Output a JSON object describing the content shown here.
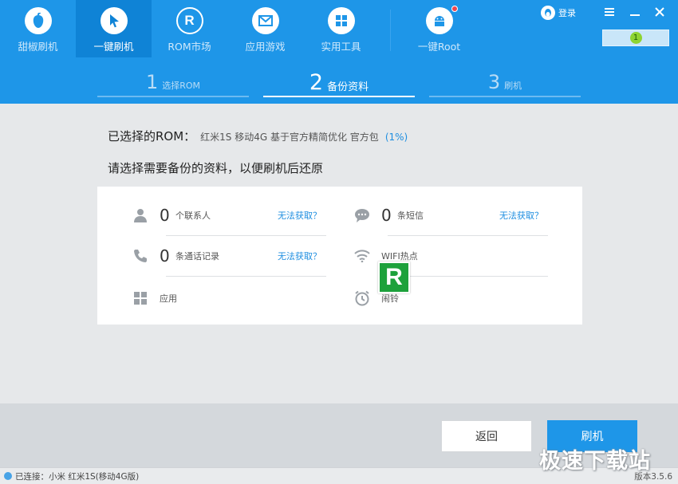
{
  "nav": {
    "items": [
      {
        "label": "甜椒刷机",
        "icon": "pepper-icon"
      },
      {
        "label": "一键刷机",
        "icon": "cursor-icon"
      },
      {
        "label": "ROM市场",
        "icon": "rom-r-icon"
      },
      {
        "label": "应用游戏",
        "icon": "mail-icon"
      },
      {
        "label": "实用工具",
        "icon": "grid-icon"
      },
      {
        "label": "一键Root",
        "icon": "android-icon"
      }
    ],
    "active_index": 1
  },
  "header": {
    "login_label": "登录",
    "device_badge": "1"
  },
  "steps": [
    {
      "num": "1",
      "label": "选择ROM"
    },
    {
      "num": "2",
      "label": "备份资料"
    },
    {
      "num": "3",
      "label": "刷机"
    }
  ],
  "rom": {
    "label": "已选择的ROM：",
    "name": "红米1S 移动4G 基于官方精简优化 官方包",
    "percent": "(1%)"
  },
  "backup_title": "请选择需要备份的资料，以便刷机后还原",
  "backup_items": {
    "contacts": {
      "count": "0",
      "name": "个联系人",
      "link": "无法获取？",
      "icon": "person-icon"
    },
    "sms": {
      "count": "0",
      "name": "条短信",
      "link": "无法获取？",
      "icon": "chat-bubble-icon"
    },
    "calls": {
      "count": "0",
      "name": "条通话记录",
      "link": "无法获取？",
      "icon": "phone-icon"
    },
    "wifi": {
      "name": "WIFI热点",
      "icon": "wifi-icon"
    },
    "apps": {
      "name": "应用",
      "icon": "apps-grid-icon"
    },
    "alarm": {
      "name": "闹铃",
      "icon": "alarm-clock-icon"
    }
  },
  "buttons": {
    "back": "返回",
    "flash": "刷机"
  },
  "status": {
    "connection": "已连接：小米 红米1S(移动4G版)",
    "version": "版本3.5.6"
  },
  "watermark": "极速下载站",
  "colors": {
    "primary_blue": "#1e96e8",
    "active_nav": "#0f83d6",
    "link_blue": "#1e8ee0",
    "badge_green": "#8ed431",
    "logo_green": "#1da13b"
  }
}
